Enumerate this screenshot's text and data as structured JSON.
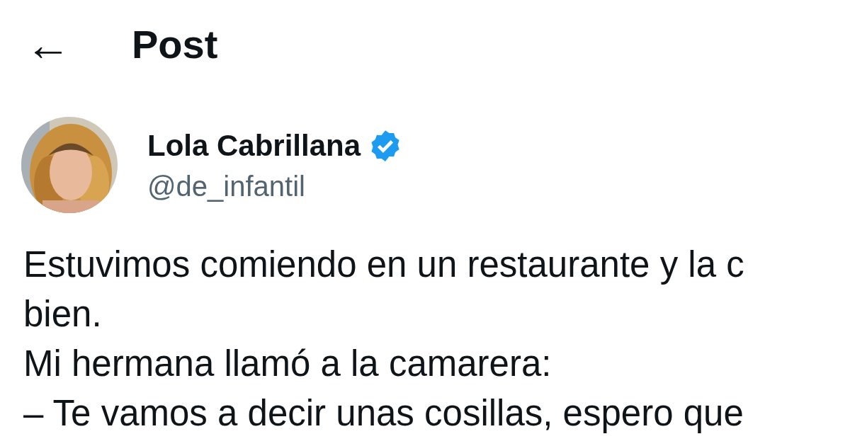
{
  "header": {
    "back_icon": "←",
    "title": "Post"
  },
  "author": {
    "name": "Lola Cabrillana",
    "verified": true,
    "handle": "@de_infantil"
  },
  "post": {
    "lines": [
      "Estuvimos comiendo en un restaurante y la c",
      "bien.",
      "Mi hermana llamó a la camarera:",
      "– Te vamos a decir unas cosillas, espero que"
    ]
  }
}
